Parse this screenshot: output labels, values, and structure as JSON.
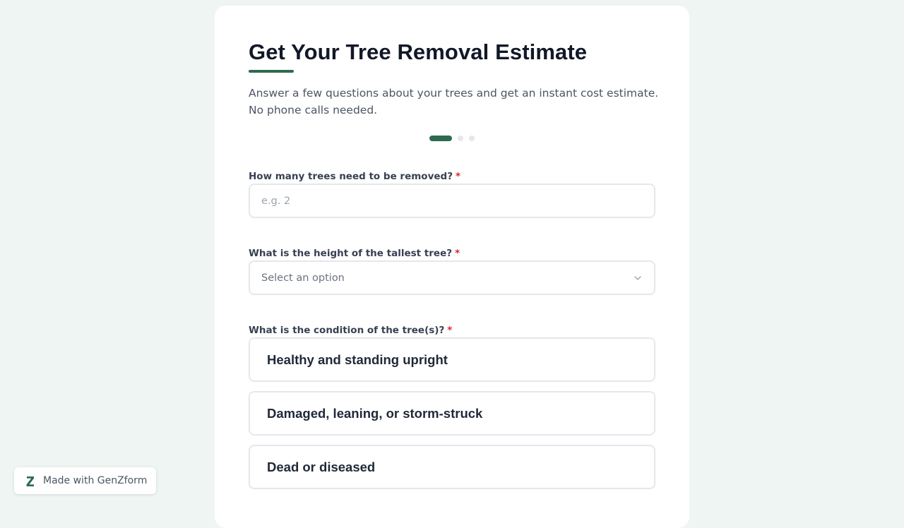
{
  "colors": {
    "accent": "#2c6b4f",
    "step_inactive": "#e5e7eb",
    "required": "#dc2626",
    "page_background": "#eff5f2"
  },
  "form": {
    "title": "Get Your Tree Removal Estimate",
    "subtitle": "Answer a few questions about your trees and get an instant cost estimate. No phone calls needed.",
    "progress": {
      "current_step": 1,
      "total_steps": 3
    },
    "questions": [
      {
        "label": "How many trees need to be removed?",
        "required_mark": "*",
        "type": "text",
        "value": "",
        "placeholder": "e.g. 2"
      },
      {
        "label": "What is the height of the tallest tree?",
        "required_mark": "*",
        "type": "select",
        "selected": "Select an option",
        "icon": "chevron-down-icon"
      },
      {
        "label": "What is the condition of the tree(s)?",
        "required_mark": "*",
        "type": "choice",
        "options": [
          "Healthy and standing upright",
          "Damaged, leaning, or storm-struck",
          "Dead or diseased"
        ]
      }
    ]
  },
  "badge": {
    "icon": "genzform-logo-icon",
    "text": "Made with GenZform"
  }
}
